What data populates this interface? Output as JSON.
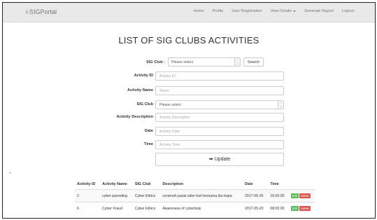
{
  "nav": {
    "brand": "i-SIGPortal",
    "links": [
      "Home",
      "Profile",
      "User Registration",
      "View Details",
      "Generate Report",
      "Logout"
    ]
  },
  "page": {
    "title": "LIST OF SIG CLUBS ACTIVITIES"
  },
  "filter": {
    "label": "SIG Club :",
    "selected": "Please select",
    "search_label": "Search"
  },
  "form": {
    "activity_id": {
      "label": "Activity ID",
      "placeholder": "Activity ID"
    },
    "activity_name": {
      "label": "Activity Name",
      "placeholder": "Name"
    },
    "sig_club": {
      "label": "SIG Club",
      "selected": "Please select"
    },
    "activity_description": {
      "label": "Activity Description",
      "placeholder": "Activity Description"
    },
    "date": {
      "label": "Date",
      "placeholder": "Activity Date"
    },
    "time": {
      "label": "Time",
      "placeholder": "Activity Time"
    },
    "update_label": "Update"
  },
  "table": {
    "headers": [
      "Activity ID",
      "Activity Name",
      "SIG Club",
      "Description",
      "Date",
      "Time"
    ],
    "rows": [
      {
        "id": "2",
        "name": "cyber parenting",
        "club": "Cyber Ethics",
        "description": "ceramah pasal siber buli bersama ibu bapa",
        "date": "2017-05-26",
        "time": "16:03:00",
        "edit": "Edit",
        "delete": "Delete"
      },
      {
        "id": "6",
        "name": "Cyber Fraud",
        "club": "Cyber Ethics",
        "description": "Awareness of cyberbuly",
        "date": "2017-05-20",
        "time": "08:00:00",
        "edit": "Edit",
        "delete": "Delete"
      }
    ]
  },
  "icons": {
    "update": "arrow-right-icon",
    "dropdown": "dropdown-arrow-icon"
  },
  "colors": {
    "edit": "#5cb85c",
    "delete": "#d9534f",
    "navbar": "#e9e9e9"
  }
}
